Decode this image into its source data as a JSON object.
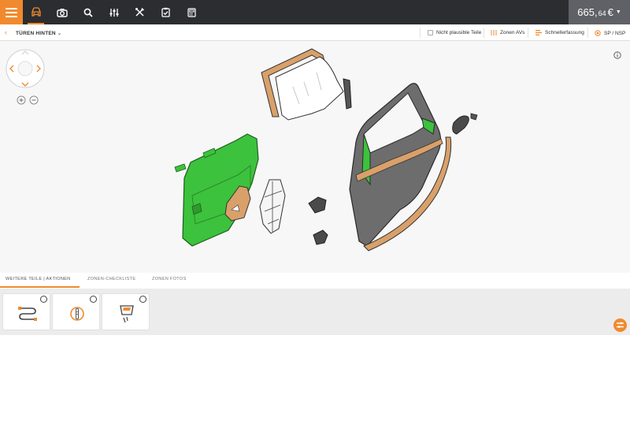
{
  "topbar": {
    "price_main": "665,",
    "price_cents": "64",
    "currency": "€",
    "icons": [
      "menu-icon",
      "car-icon",
      "camera-icon",
      "search-icon",
      "sliders-icon",
      "tools-icon",
      "clipboard-icon",
      "calculator-icon"
    ]
  },
  "subbar": {
    "zone_title": "TÜREN HINTEN",
    "implausible_label": "Nicht plausible Teile",
    "zones_label": "Zonen AVs",
    "quick_label": "Schnellerfassung",
    "sp_label": "SP / NSP"
  },
  "tabs": [
    {
      "label": "WEITERE TEILE | AKTIONEN"
    },
    {
      "label": "ZONEN-CHECKLISTE"
    },
    {
      "label": "ZONEN FOTOS"
    }
  ],
  "colors": {
    "accent": "#f18a2e",
    "topbar": "#2b2d30",
    "price_bg": "#5f6166",
    "selected_part": "#3cc23c",
    "seal": "#d9a06a",
    "door_shell": "#6d6d6d"
  }
}
